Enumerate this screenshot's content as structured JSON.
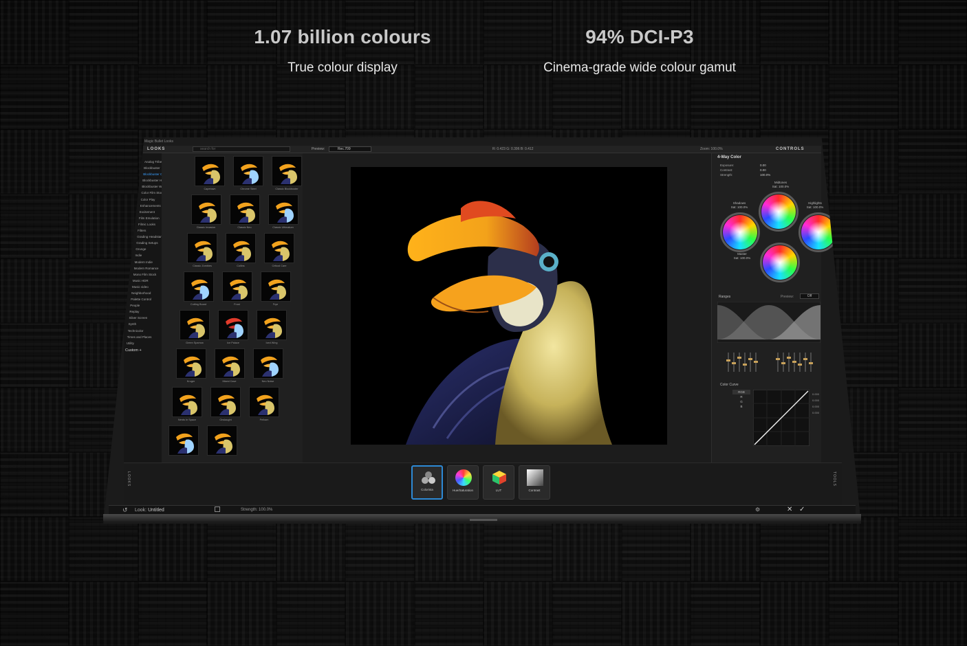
{
  "headline": [
    {
      "title": "1.07 billion colours",
      "subtitle": "True colour display"
    },
    {
      "title": "94% DCI-P3",
      "subtitle": "Cinema-grade wide colour gamut"
    }
  ],
  "app": {
    "window_title": "Magic Bullet Looks",
    "looks_header": "LOOKS",
    "controls_header": "CONTROLS",
    "search_placeholder": "search for",
    "preview_label": "Preview:",
    "preview_value": "Rec.709",
    "pixel_readout": "R: 0.423   G: 0.396   B: 0.412",
    "zoom": "Zoom: 100.0%"
  },
  "categories": [
    "Analog Tribe",
    "Blockbuster",
    "Blockbuster Cool",
    "Blockbuster HDR",
    "Blockbuster Warm",
    "Color Film Stock",
    "Color Play",
    "Enhancements",
    "Excitement",
    "Film Emulation",
    "Filmic Looks",
    "Filters",
    "Grading Headstarts",
    "Grading Setups",
    "Grunge",
    "Indie",
    "Modern Indie",
    "Modern Romance",
    "Mono Film Stock",
    "Music HDR",
    "Music video",
    "Neighborhood",
    "Palette Control",
    "People",
    "Replay",
    "Silver Screen",
    "Synth",
    "Technicolor",
    "Times and Places",
    "Utility"
  ],
  "active_category": "Blockbuster Cool",
  "custom_label": "Custom",
  "thumbnails": [
    "Capetown",
    "Chrome Steel",
    "Classic Blockbuster",
    "Classic Invasion",
    "Classic Neo",
    "Classic Ultimatum",
    "Classic Zombies",
    "Collins",
    "Critical Care",
    "Cutting Board",
    "Frost",
    "Frye",
    "Green Sparrow",
    "Ice Palace",
    "Iced Wing",
    "Kruger",
    "Miami Cave",
    "Neo Noise",
    "Nerds In Space",
    "Onslaught",
    "Pelham"
  ],
  "controls": {
    "section_title": "4-Way Color",
    "adjust_labels": [
      "Exposure:",
      "Contrast:",
      "Strength:"
    ],
    "adjust_values": [
      "0.00",
      "0.00",
      "100.0%"
    ],
    "wheels": [
      {
        "name": "Midtones",
        "sat": "Sat: 100.0%"
      },
      {
        "name": "Shadows",
        "sat": "Sat: 100.0%"
      },
      {
        "name": "Highlights",
        "sat": "Sat: 100.0%"
      },
      {
        "name": "Master",
        "sat": "Sat: 100.0%"
      }
    ],
    "ranges_label": "Ranges",
    "ranges_preview": "Preview:",
    "ranges_preview_value": "Off",
    "curve_label": "Color Curve",
    "curve_channels": [
      "RGB",
      "R",
      "G",
      "B"
    ],
    "curve_values": [
      "0.000",
      "0.000",
      "0.000",
      "0.000"
    ]
  },
  "tools": [
    {
      "label": "Colorista",
      "selected": true
    },
    {
      "label": "Hue/Saturation",
      "selected": false
    },
    {
      "label": "LUT",
      "selected": false
    },
    {
      "label": "Contrast",
      "selected": false
    }
  ],
  "side_tags": {
    "left": "LOOKS",
    "right": "TOOLS"
  },
  "status": {
    "look_label": "Look:",
    "look_name": "Untitled",
    "strength": "Strength:   100.0%"
  },
  "colors": {
    "accent": "#2d8ad6",
    "active_category": "#3aa0ff"
  }
}
